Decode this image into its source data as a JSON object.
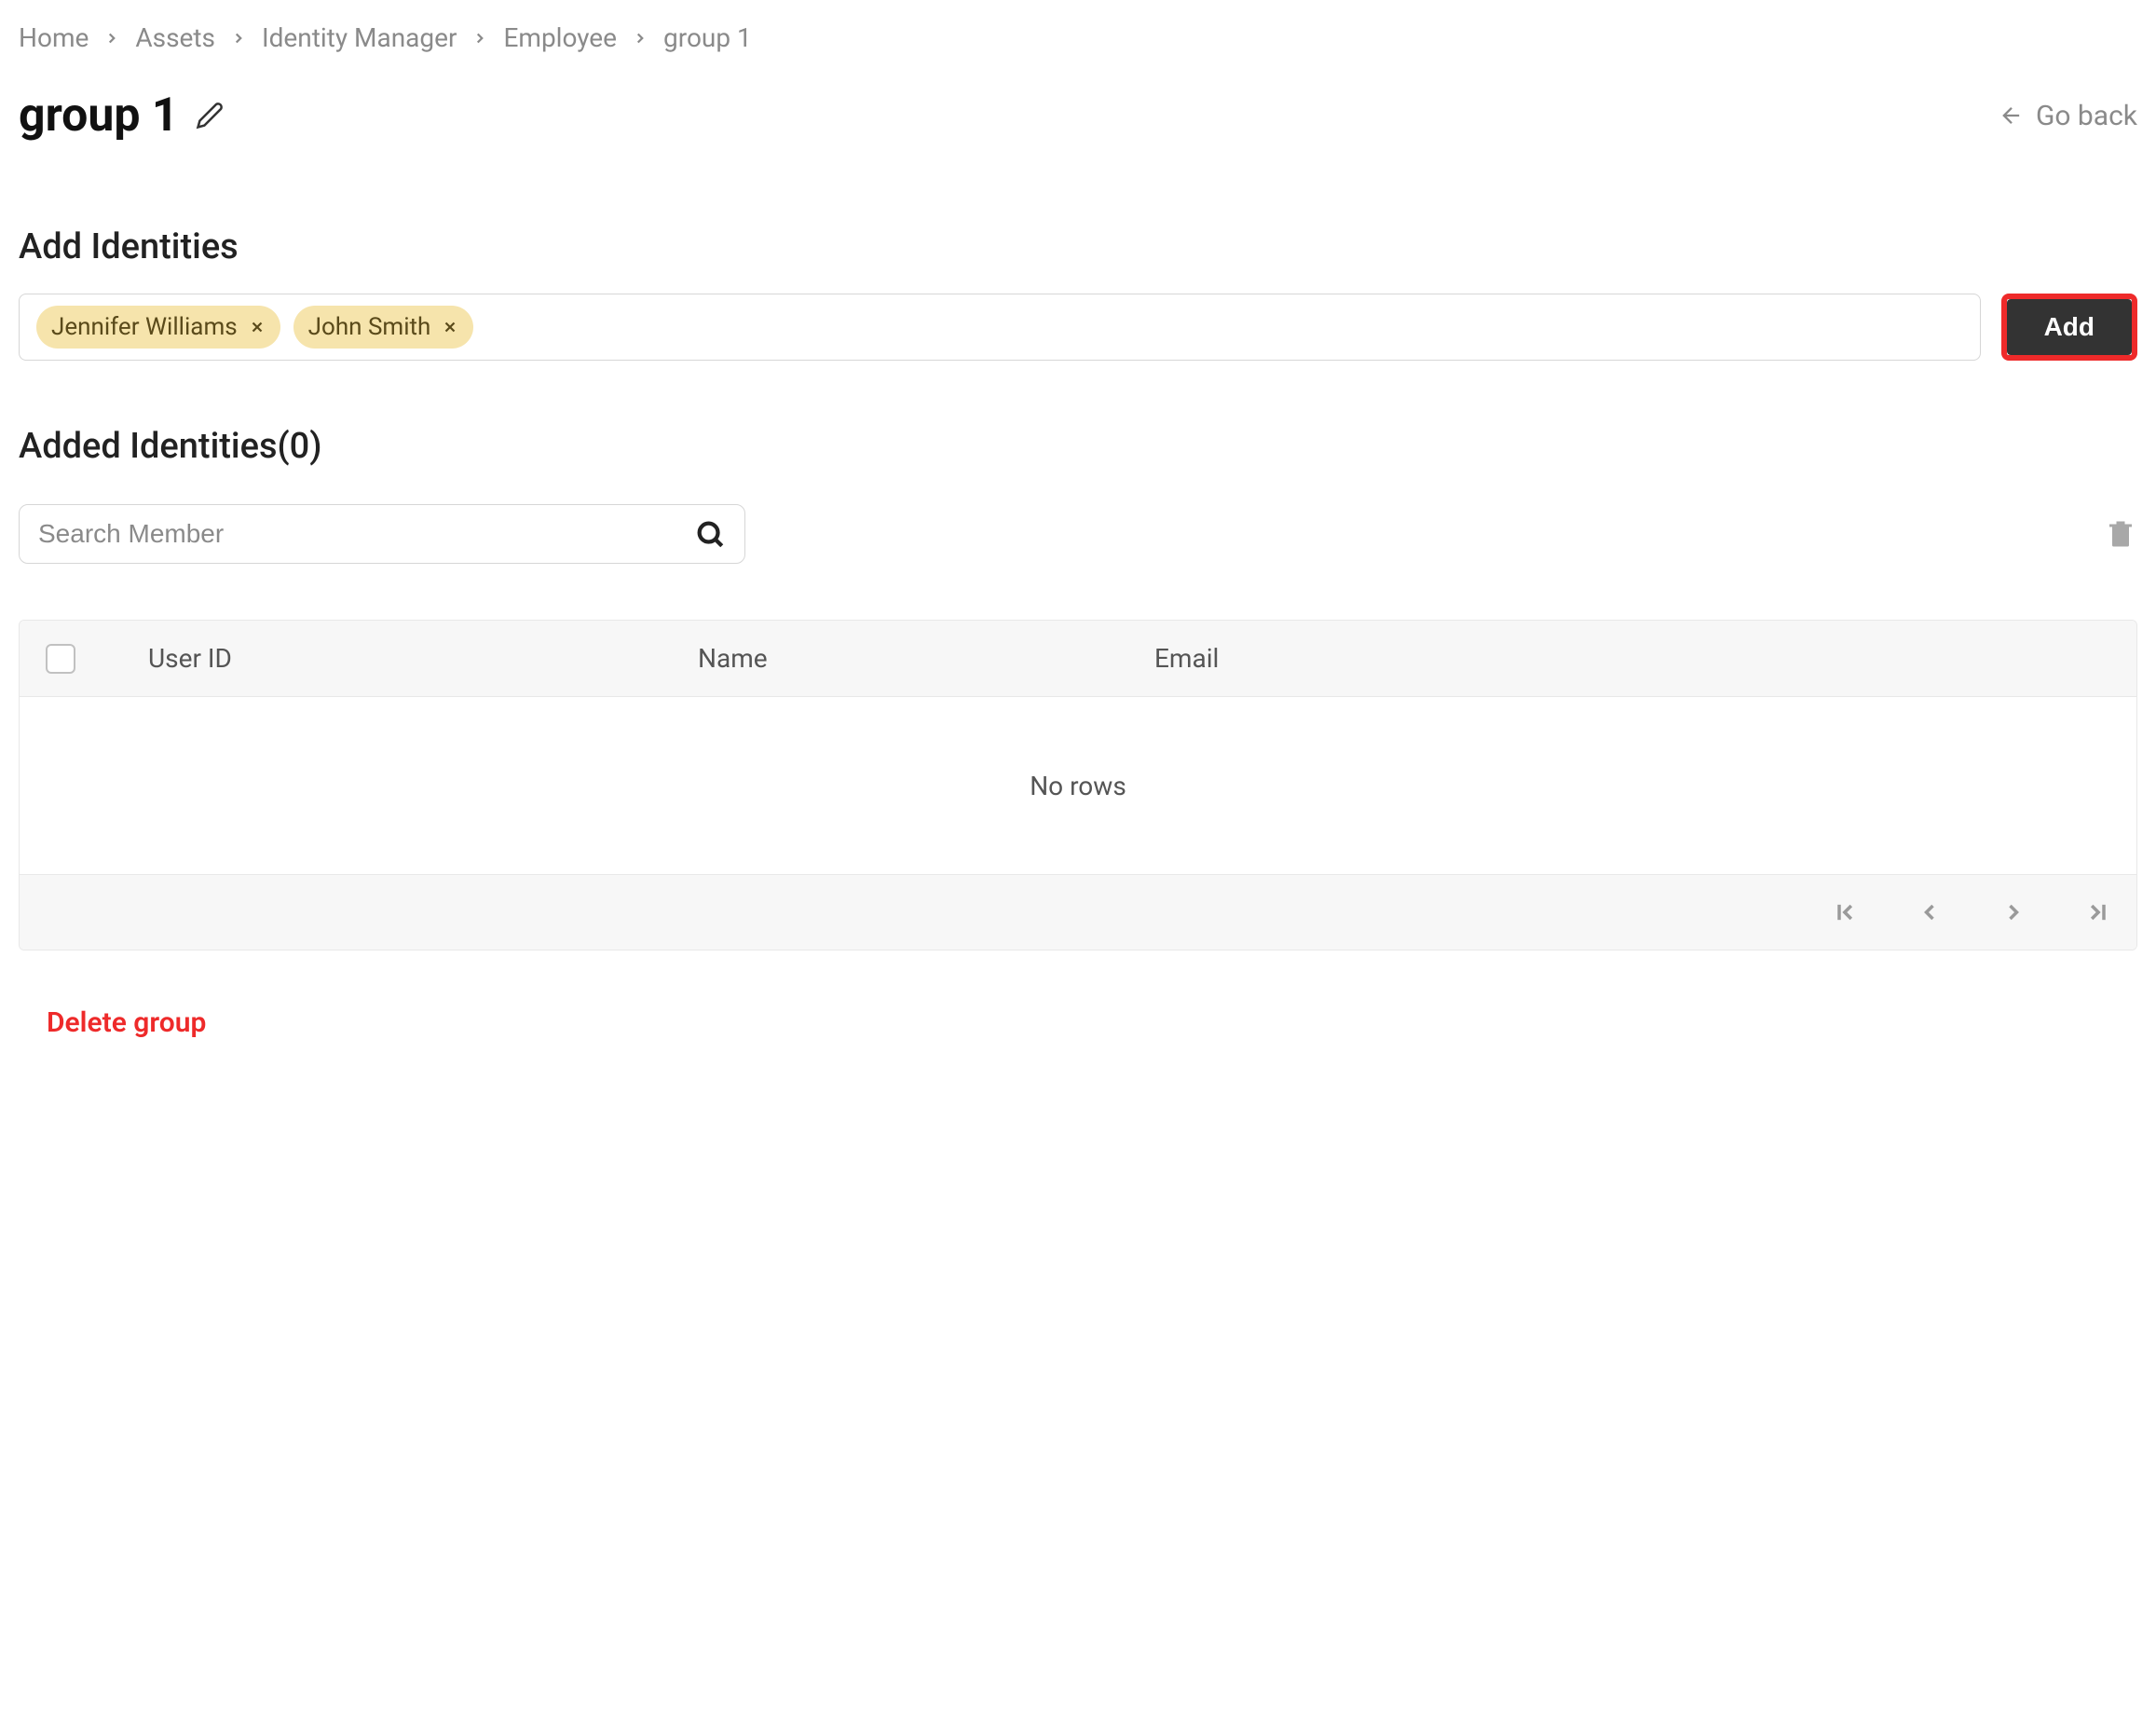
{
  "breadcrumb": {
    "items": [
      "Home",
      "Assets",
      "Identity Manager",
      "Employee",
      "group 1"
    ]
  },
  "header": {
    "title": "group 1",
    "go_back_label": "Go back"
  },
  "add_identities": {
    "heading": "Add Identities",
    "tags": [
      "Jennifer Williams",
      "John Smith"
    ],
    "add_button_label": "Add"
  },
  "added_identities": {
    "heading": "Added Identities(0)",
    "search_placeholder": "Search Member"
  },
  "table": {
    "columns": {
      "user_id": "User ID",
      "name": "Name",
      "email": "Email"
    },
    "empty_message": "No rows"
  },
  "actions": {
    "delete_group_label": "Delete group"
  }
}
